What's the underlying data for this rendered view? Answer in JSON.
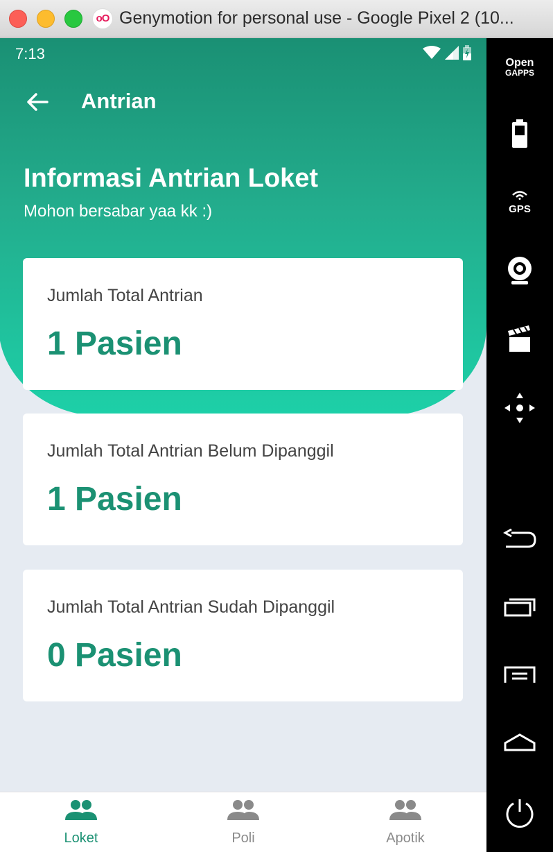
{
  "window": {
    "title": "Genymotion for personal use - Google Pixel 2 (10...",
    "logo_text": "oO"
  },
  "statusbar": {
    "time": "7:13"
  },
  "appbar": {
    "title": "Antrian"
  },
  "header": {
    "headline": "Informasi Antrian Loket",
    "subline": "Mohon bersabar yaa kk :)"
  },
  "cards": [
    {
      "label": "Jumlah Total Antrian",
      "value": "1 Pasien"
    },
    {
      "label": "Jumlah Total Antrian Belum Dipanggil",
      "value": "1 Pasien"
    },
    {
      "label": "Jumlah Total Antrian Sudah Dipanggil",
      "value": "0 Pasien"
    }
  ],
  "bottom_nav": {
    "items": [
      {
        "label": "Loket",
        "icon": "people-icon",
        "active": true
      },
      {
        "label": "Poli",
        "icon": "people-icon",
        "active": false
      },
      {
        "label": "Apotik",
        "icon": "people-icon",
        "active": false
      }
    ]
  },
  "sidebar": {
    "opengapps_top": "Open",
    "opengapps_bottom": "GAPPS",
    "gps_label": "GPS",
    "buttons": [
      "opengapps-icon",
      "battery-icon",
      "gps-icon",
      "webcam-icon",
      "media-icon",
      "dpad-icon",
      "back-icon",
      "recent-apps-icon",
      "menu-icon",
      "home-icon",
      "power-icon"
    ]
  },
  "colors": {
    "primary_dark": "#1a9074",
    "primary_light": "#1dd0a8",
    "value_text": "#1b9173",
    "nav_active": "#1b9173",
    "nav_inactive": "#8a8a8a"
  }
}
